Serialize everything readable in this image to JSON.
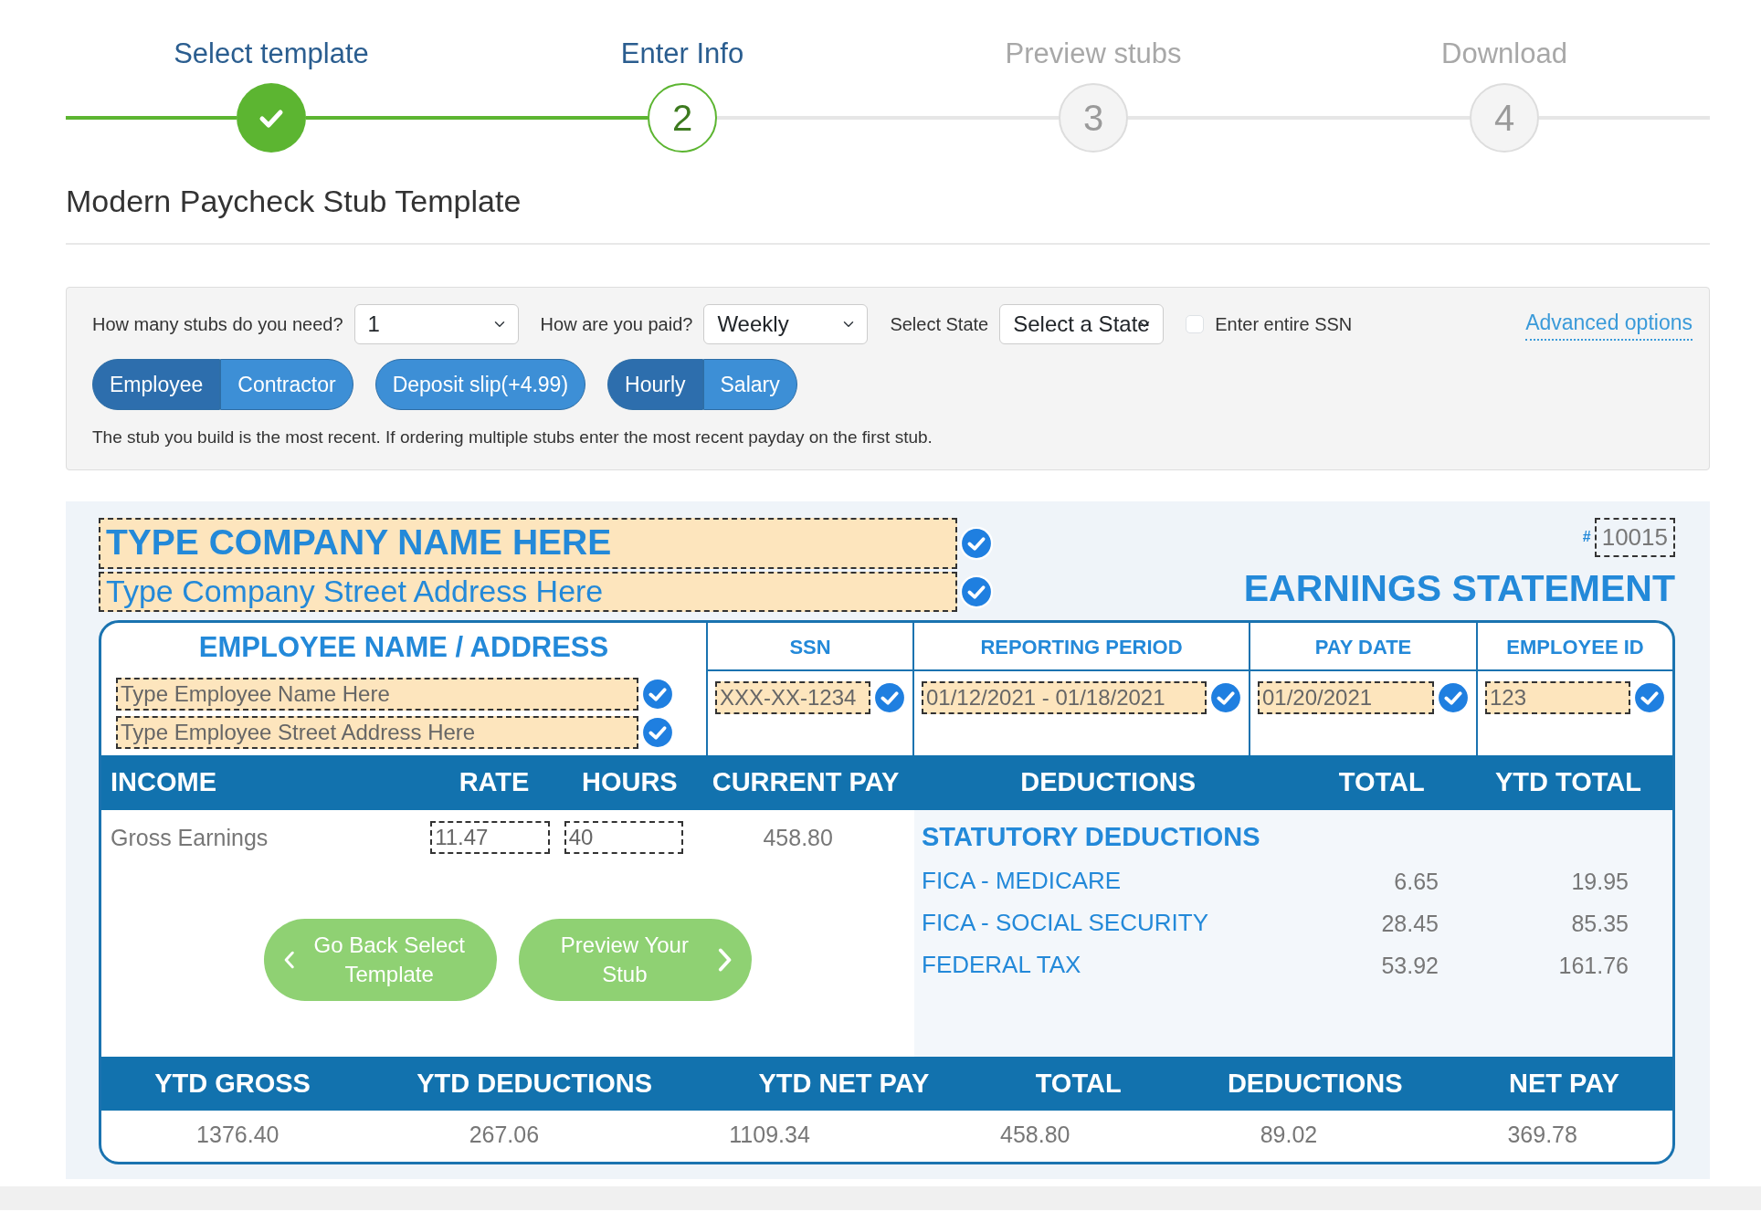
{
  "steps": [
    {
      "label": "Select template",
      "completed": true,
      "selected": false
    },
    {
      "label": "Enter Info",
      "completed": false,
      "selected": true,
      "number": "2"
    },
    {
      "label": "Preview stubs",
      "completed": false,
      "selected": false,
      "number": "3"
    },
    {
      "label": "Download",
      "completed": false,
      "selected": false,
      "number": "4"
    }
  ],
  "title": "Modern Paycheck Stub Template",
  "options": {
    "stubs_count": {
      "label": "How many stubs do you need?",
      "value": "1"
    },
    "pay_frequency": {
      "label": "How are you paid?",
      "value": "Weekly"
    },
    "state": {
      "label": "Select State",
      "value": "Select a State"
    },
    "ssn_checkbox": {
      "label": "Enter entire SSN",
      "checked": false
    },
    "advanced_link": "Advanced options",
    "worker_type": [
      {
        "label": "Employee",
        "selected": true
      },
      {
        "label": "Contractor",
        "selected": false
      }
    ],
    "deposit_slip": "Deposit slip(+4.99)",
    "pay_type": [
      {
        "label": "Hourly",
        "selected": true
      },
      {
        "label": "Salary",
        "selected": false
      }
    ],
    "note": "The stub you build is the most recent. If ordering multiple stubs enter the most recent payday on the first stub."
  },
  "stub": {
    "company_name": {
      "placeholder": "TYPE COMPANY NAME HERE"
    },
    "company_address": {
      "placeholder": "Type Company Street Address Here"
    },
    "number_sign": "#",
    "number": "10015",
    "statement_title": "EARNINGS STATEMENT",
    "employee_heading": "EMPLOYEE NAME / ADDRESS",
    "employee_name": {
      "placeholder": "Type Employee Name Here"
    },
    "employee_address": {
      "placeholder": "Type Employee Street Address Here"
    },
    "info_columns": [
      {
        "heading": "SSN",
        "value": "XXX-XX-1234"
      },
      {
        "heading": "REPORTING PERIOD",
        "value": "01/12/2021 - 01/18/2021"
      },
      {
        "heading": "PAY DATE",
        "value": "01/20/2021"
      },
      {
        "heading": "EMPLOYEE ID",
        "value": "123"
      }
    ],
    "income_columns": [
      "INCOME",
      "RATE",
      "HOURS",
      "CURRENT PAY",
      "DEDUCTIONS",
      "TOTAL",
      "YTD TOTAL"
    ],
    "income_row": {
      "label": "Gross Earnings",
      "rate": "11.47",
      "hours": "40",
      "current_pay": "458.80"
    },
    "deduction_section": "STATUTORY DEDUCTIONS",
    "deductions": [
      {
        "name": "FICA - MEDICARE",
        "total": "6.65",
        "ytd_total": "19.95"
      },
      {
        "name": "FICA - SOCIAL SECURITY",
        "total": "28.45",
        "ytd_total": "85.35"
      },
      {
        "name": "FEDERAL TAX",
        "total": "53.92",
        "ytd_total": "161.76"
      }
    ],
    "buttons": {
      "back": "Go Back Select Template",
      "preview": "Preview Your Stub"
    },
    "summary_columns": [
      {
        "heading": "YTD GROSS",
        "value": "1376.40"
      },
      {
        "heading": "YTD DEDUCTIONS",
        "value": "267.06"
      },
      {
        "heading": "YTD NET PAY",
        "value": "1109.34"
      },
      {
        "heading": "TOTAL",
        "value": "458.80"
      },
      {
        "heading": "DEDUCTIONS",
        "value": "89.02"
      },
      {
        "heading": "NET PAY",
        "value": "369.78"
      }
    ]
  }
}
